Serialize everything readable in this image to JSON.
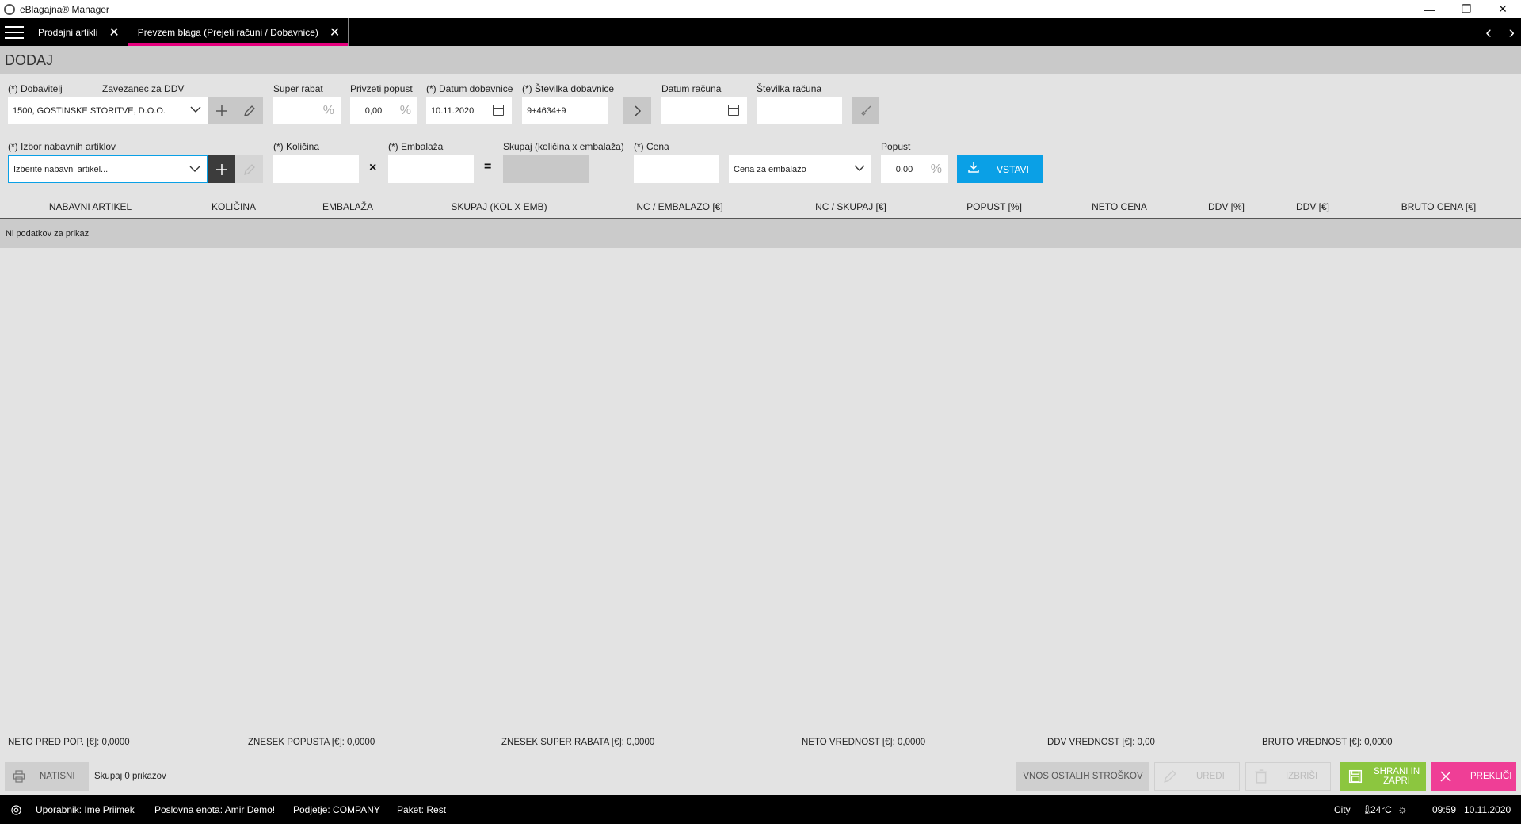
{
  "window": {
    "title": "eBlagajna® Manager",
    "minimize": "—",
    "restore": "❐",
    "close": "✕"
  },
  "tabs": [
    {
      "label": "Prodajni artikli",
      "close": "✕"
    },
    {
      "label": "Prevzem blaga (Prejeti računi / Dobavnice)",
      "close": "✕"
    }
  ],
  "nav": {
    "prev": "‹",
    "next": "›"
  },
  "section_title": "DODAJ",
  "form": {
    "dobavitelj_label": "(*) Dobavitelj",
    "dobavitelj_value": "1500, GOSTINSKE STORITVE, D.O.O.",
    "zavezanec_label": "Zavezanec za DDV",
    "super_rabat_label": "Super rabat",
    "super_rabat_value": "",
    "percent": "%",
    "privzeti_popust_label": "Privzeti popust",
    "privzeti_popust_value": "0,00",
    "datum_dobavnice_label": "(*) Datum dobavnice",
    "datum_dobavnice_value": "10.11.2020",
    "stevilka_dobavnice_label": "(*) Številka dobavnice",
    "stevilka_dobavnice_value": "9+4634+9",
    "datum_racuna_label": "Datum računa",
    "datum_racuna_value": "",
    "stevilka_racuna_label": "Številka računa",
    "stevilka_racuna_value": "",
    "izbor_label": "(*) Izbor nabavnih artiklov",
    "izbor_placeholder": "Izberite nabavni artikel...",
    "kolicina_label": "(*) Količina",
    "embalaza_label": "(*) Embalaža",
    "skupaj_label": "Skupaj (količina x embalaža)",
    "cena_label": "(*) Cena",
    "cena_tip_value": "Cena za embalažo",
    "popust_label": "Popust",
    "popust_value": "0,00",
    "times": "×",
    "equals": "=",
    "plus": "+",
    "vstavi_label": "VSTAVI"
  },
  "table": {
    "columns": [
      "NABAVNI ARTIKEL",
      "KOLIČINA",
      "EMBALAŽA",
      "SKUPAJ (KOL X EMB)",
      "NC / EMBALAZO [€]",
      "NC / SKUPAJ [€]",
      "POPUST [%]",
      "NETO CENA",
      "DDV [%]",
      "DDV [€]",
      "BRUTO CENA [€]"
    ],
    "empty_text": "Ni podatkov za prikaz"
  },
  "totals": {
    "neto_pred_pop": "NETO PRED POP. [€]: 0,0000",
    "znesek_popusta": "ZNESEK POPUSTA [€]: 0,0000",
    "znesek_super_rabata": "ZNESEK SUPER RABATA [€]: 0,0000",
    "neto_vrednost": "NETO VREDNOST [€]: 0,0000",
    "ddv_vrednost": "DDV VREDNOST [€]: 0,00",
    "bruto_vrednost": "BRUTO VREDNOST [€]: 0,0000"
  },
  "actions": {
    "natisni": "NATISNI",
    "skupaj_count": "Skupaj 0 prikazov",
    "vnos_stroskov": "VNOS OSTALIH STROŠKOV",
    "uredi": "UREDI",
    "izbrisi": "IZBRIŠI",
    "shrani_line1": "SHRANI IN",
    "shrani_line2": "ZAPRI",
    "preklici": "PREKLIČI"
  },
  "status": {
    "uporabnik": "Uporabnik: Ime Priimek",
    "poslovna_enota": "Poslovna enota: Amir Demo!",
    "podjetje": "Podjetje: COMPANY",
    "paket": "Paket: Rest",
    "city": "City",
    "temperature": "24°C",
    "time": "09:59",
    "date": "10.11.2020"
  },
  "colors": {
    "accent_pink": "#e6007e",
    "vstavi_blue": "#0aa0e6",
    "save_green": "#8cc63f",
    "cancel_pink": "#ef3e96"
  }
}
